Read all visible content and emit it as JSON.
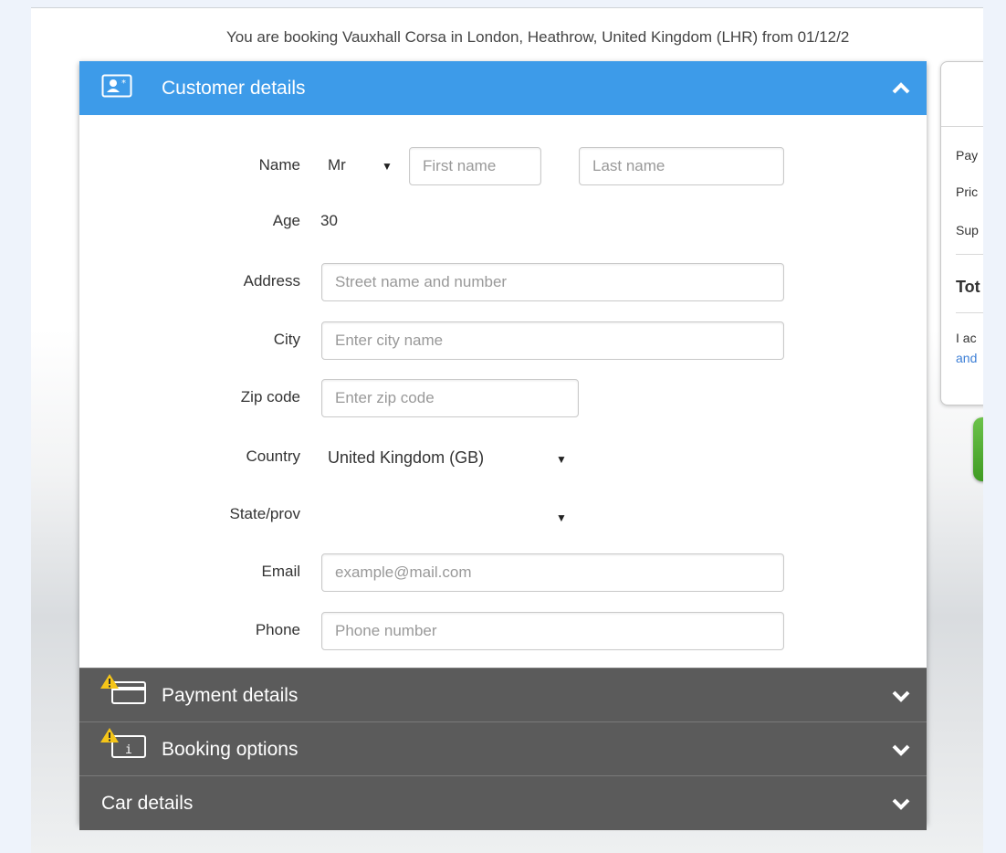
{
  "booking_summary": "You are booking Vauxhall Corsa in London, Heathrow, United Kingdom (LHR) from 01/12/2",
  "sections": {
    "customer": {
      "title": "Customer details",
      "icon": "contact-card-icon"
    },
    "payment": {
      "title": "Payment details",
      "icon": "credit-card-icon",
      "warning": "warning-icon"
    },
    "options": {
      "title": "Booking options",
      "icon": "info-card-icon",
      "warning": "warning-icon"
    },
    "car": {
      "title": "Car details"
    }
  },
  "form": {
    "name_label": "Name",
    "title_value": "Mr",
    "first_name_placeholder": "First name",
    "last_name_placeholder": "Last name",
    "age_label": "Age",
    "age_value": "30",
    "address_label": "Address",
    "address_placeholder": "Street name and number",
    "city_label": "City",
    "city_placeholder": "Enter city name",
    "zip_label": "Zip code",
    "zip_placeholder": "Enter zip code",
    "country_label": "Country",
    "country_value": "United Kingdom (GB)",
    "state_label": "State/prov",
    "state_value": "",
    "email_label": "Email",
    "email_placeholder": "example@mail.com",
    "phone_label": "Phone",
    "phone_placeholder": "Phone number"
  },
  "side_panel": {
    "line1": "Pay",
    "line2": "Pric",
    "line3": "Sup",
    "total": "Tot",
    "terms1": "I ac",
    "terms2": "and"
  },
  "colors": {
    "header_active": "#3d9be9",
    "header_inactive": "#5b5b5b",
    "link": "#3d7fd6",
    "confirm_green": "#4caf2a"
  }
}
